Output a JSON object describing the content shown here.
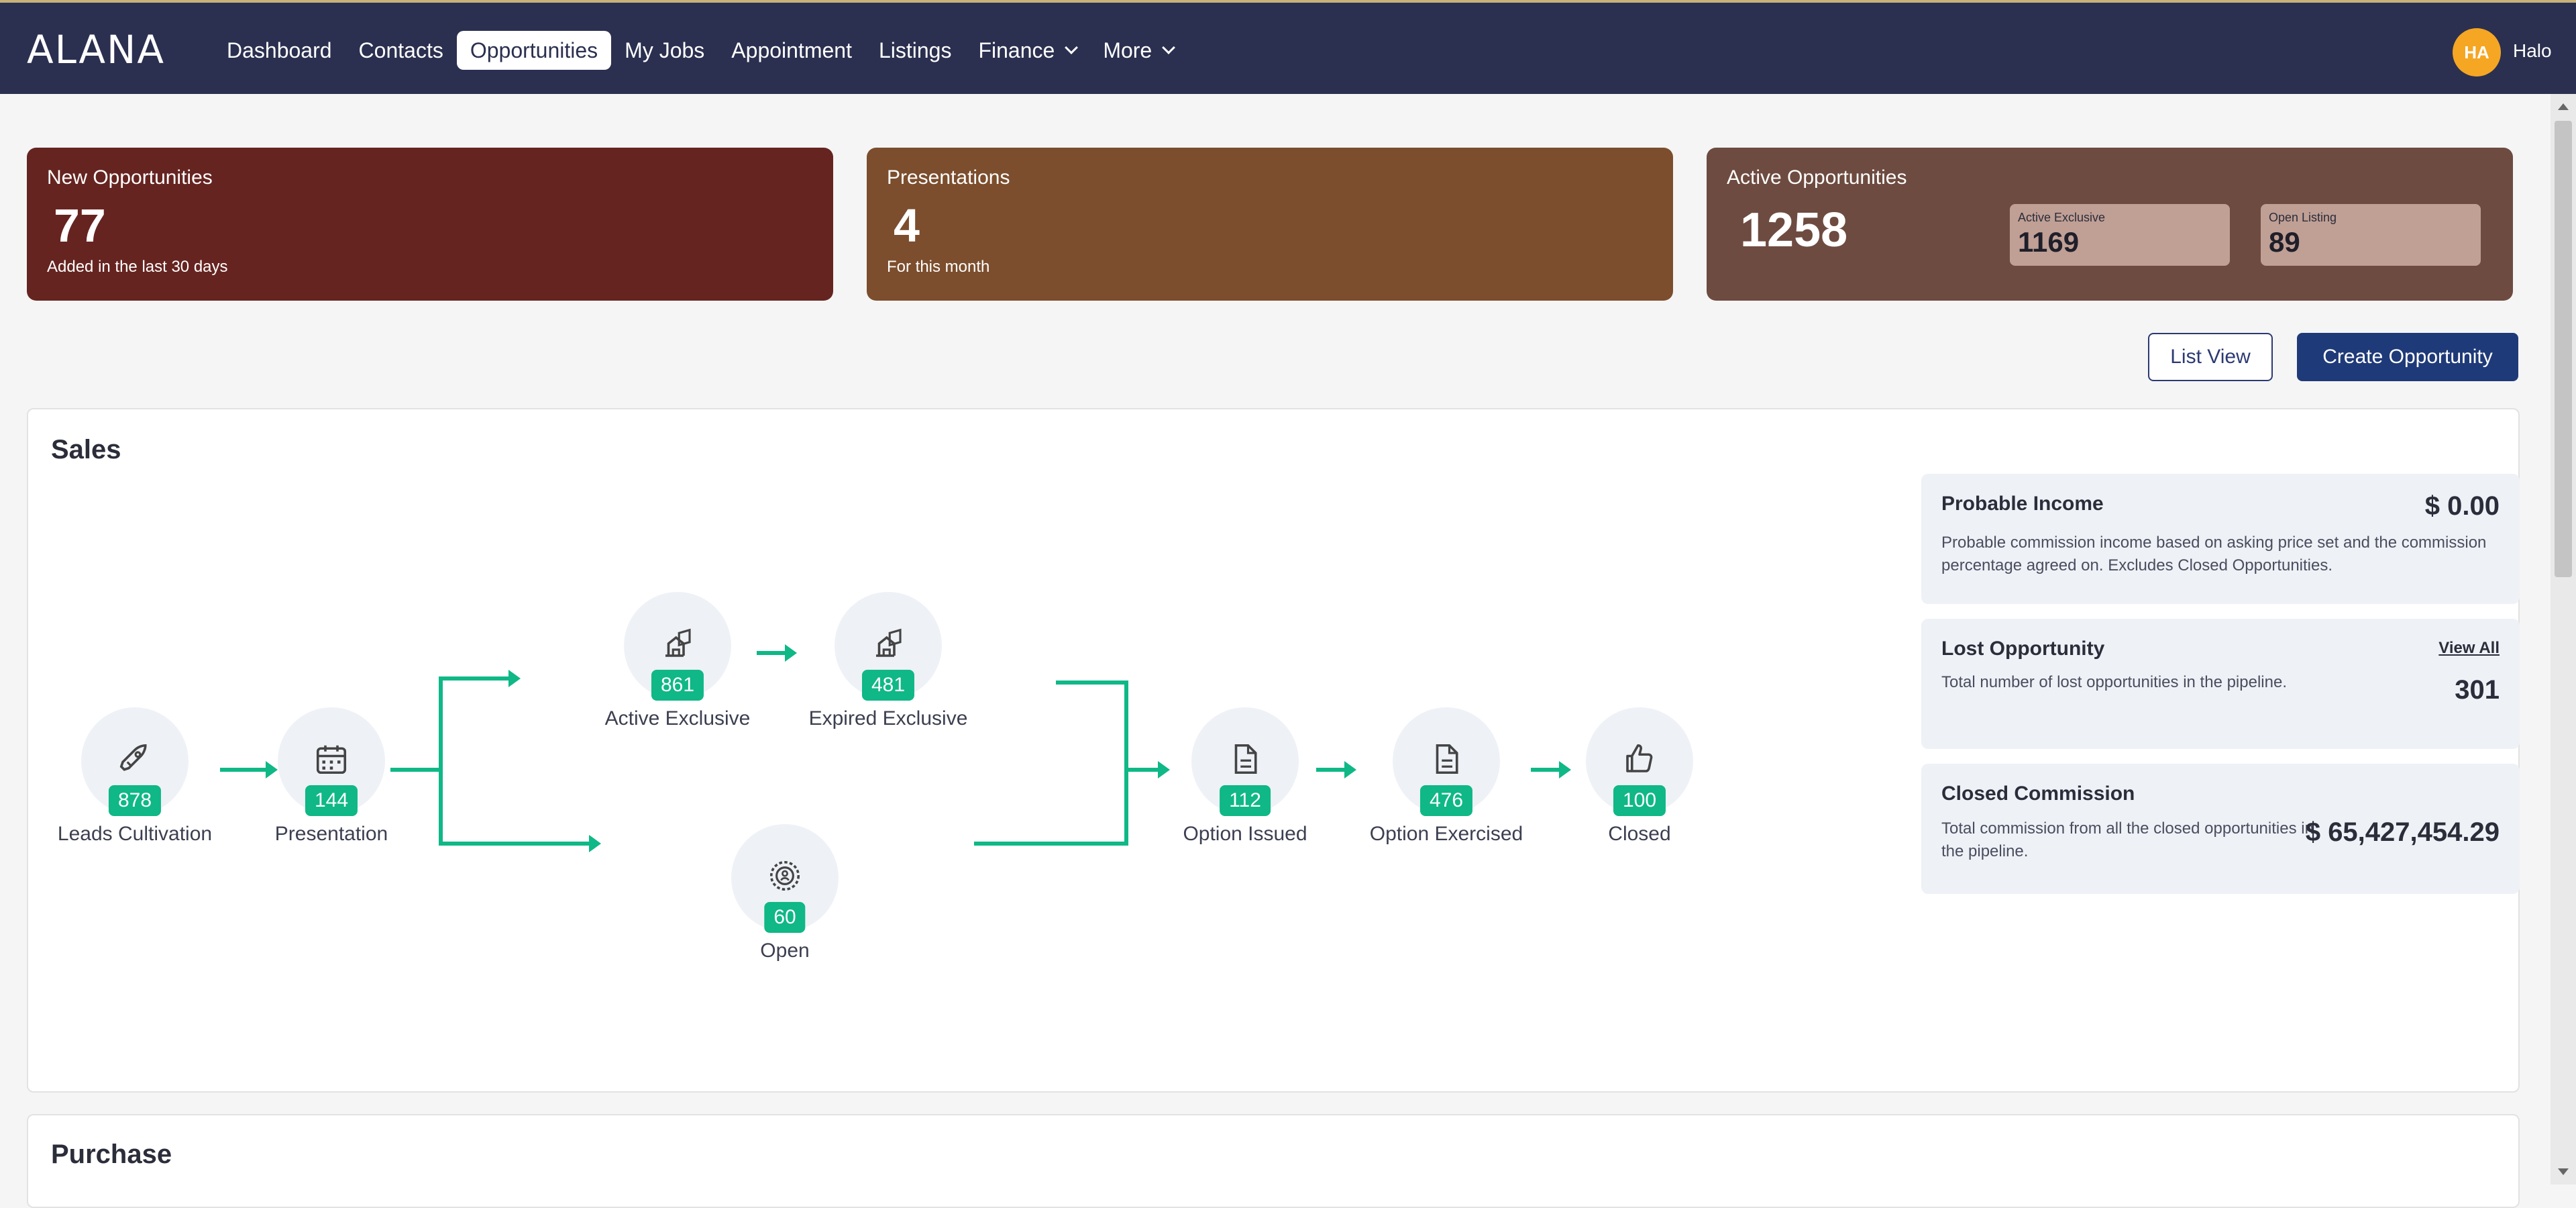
{
  "app": {
    "logo": "ALANA"
  },
  "nav": {
    "items": [
      {
        "label": "Dashboard"
      },
      {
        "label": "Contacts"
      },
      {
        "label": "Opportunities"
      },
      {
        "label": "My Jobs"
      },
      {
        "label": "Appointment"
      },
      {
        "label": "Listings"
      },
      {
        "label": "Finance"
      },
      {
        "label": "More"
      }
    ],
    "active": "Opportunities"
  },
  "user": {
    "initials": "HA",
    "name": "Halo",
    "avatar_color": "#f5a623"
  },
  "stats": {
    "new": {
      "label": "New Opportunities",
      "value": "77",
      "sub": "Added in the last 30 days",
      "color": "#662420"
    },
    "presentations": {
      "label": "Presentations",
      "value": "4",
      "sub": "For this month",
      "color": "#7c4e2d"
    },
    "active": {
      "label": "Active Opportunities",
      "value": "1258",
      "color": "#6e4b40",
      "exclusive": {
        "label": "Active Exclusive",
        "value": "1169"
      },
      "open": {
        "label": "Open Listing",
        "value": "89"
      }
    }
  },
  "buttons": {
    "list_view": "List View",
    "create": "Create Opportunity"
  },
  "sales": {
    "title": "Sales",
    "stages": {
      "leads": {
        "label": "Leads Cultivation",
        "count": "878",
        "icon": "rocket-icon"
      },
      "presentation": {
        "label": "Presentation",
        "count": "144",
        "icon": "calendar-icon"
      },
      "active_exclusive": {
        "label": "Active Exclusive",
        "count": "861",
        "icon": "house-sign-icon"
      },
      "expired_exclusive": {
        "label": "Expired Exclusive",
        "count": "481",
        "icon": "house-sign-icon"
      },
      "open": {
        "label": "Open",
        "count": "60",
        "icon": "open-badge-icon"
      },
      "option_issued": {
        "label": "Option Issued",
        "count": "112",
        "icon": "document-icon"
      },
      "option_exercised": {
        "label": "Option Exercised",
        "count": "476",
        "icon": "document-icon"
      },
      "closed": {
        "label": "Closed",
        "count": "100",
        "icon": "thumbs-up-icon"
      }
    },
    "accent_color": "#0fb886",
    "probable_income": {
      "title": "Probable Income",
      "value": "$ 0.00",
      "desc": "Probable commission income based on asking price set and the commission percentage agreed on. Excludes Closed Opportunities."
    },
    "lost": {
      "title": "Lost Opportunity",
      "link": "View All",
      "desc": "Total number of lost opportunities in the pipeline.",
      "value": "301"
    },
    "closed_commission": {
      "title": "Closed Commission",
      "desc": "Total commission from all the closed opportunities in the pipeline.",
      "value": "$ 65,427,454.29"
    }
  },
  "purchase": {
    "title": "Purchase"
  }
}
